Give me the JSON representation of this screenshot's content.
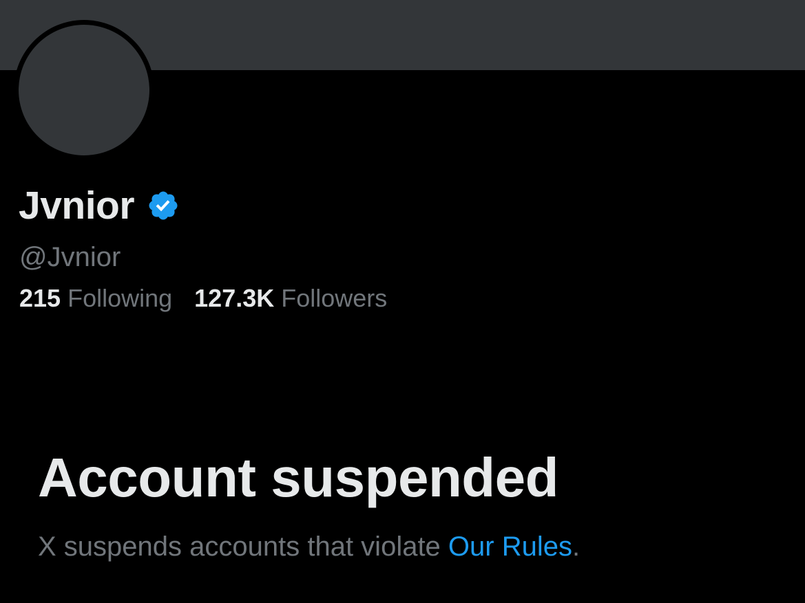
{
  "profile": {
    "display_name": "Jvnior",
    "verified_icon": "verified-badge-icon",
    "handle": "@Jvnior",
    "following_count": "215",
    "following_label": "Following",
    "followers_count": "127.3K",
    "followers_label": "Followers"
  },
  "suspension": {
    "title": "Account suspended",
    "message_prefix": "X suspends accounts that violate ",
    "rules_link": "Our Rules",
    "message_suffix": "."
  },
  "colors": {
    "background": "#000000",
    "banner": "#333639",
    "primary_text": "#e7e9ea",
    "secondary_text": "#71767b",
    "accent": "#1d9bf0"
  }
}
